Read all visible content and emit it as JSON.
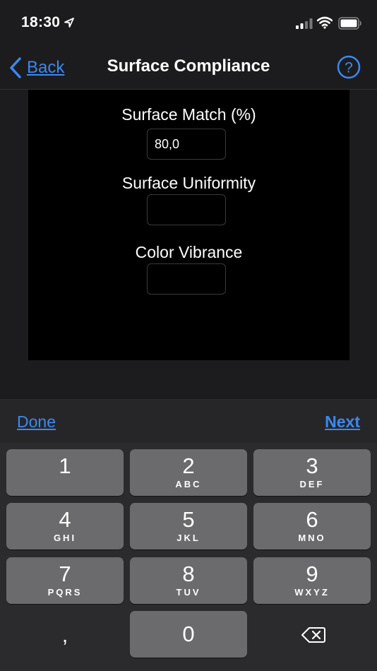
{
  "status_bar": {
    "time": "18:30"
  },
  "nav": {
    "back_label": "Back",
    "title": "Surface Compliance",
    "help_glyph": "?"
  },
  "form": {
    "fields": [
      {
        "label": "Surface Match (%)",
        "value": "80,0"
      },
      {
        "label": "Surface Uniformity",
        "value": ""
      },
      {
        "label": "Color Vibrance",
        "value": ""
      }
    ]
  },
  "toolbar": {
    "done_label": "Done",
    "next_label": "Next"
  },
  "keyboard": {
    "keys": [
      {
        "digit": "1",
        "letters": ""
      },
      {
        "digit": "2",
        "letters": "ABC"
      },
      {
        "digit": "3",
        "letters": "DEF"
      },
      {
        "digit": "4",
        "letters": "GHI"
      },
      {
        "digit": "5",
        "letters": "JKL"
      },
      {
        "digit": "6",
        "letters": "MNO"
      },
      {
        "digit": "7",
        "letters": "PQRS"
      },
      {
        "digit": "8",
        "letters": "TUV"
      },
      {
        "digit": "9",
        "letters": "WXYZ"
      },
      {
        "digit": "0",
        "letters": ""
      }
    ],
    "comma": ","
  },
  "colors": {
    "accent": "#3b89f1",
    "key": "#6b6b6d",
    "background": "#1c1c1e"
  }
}
